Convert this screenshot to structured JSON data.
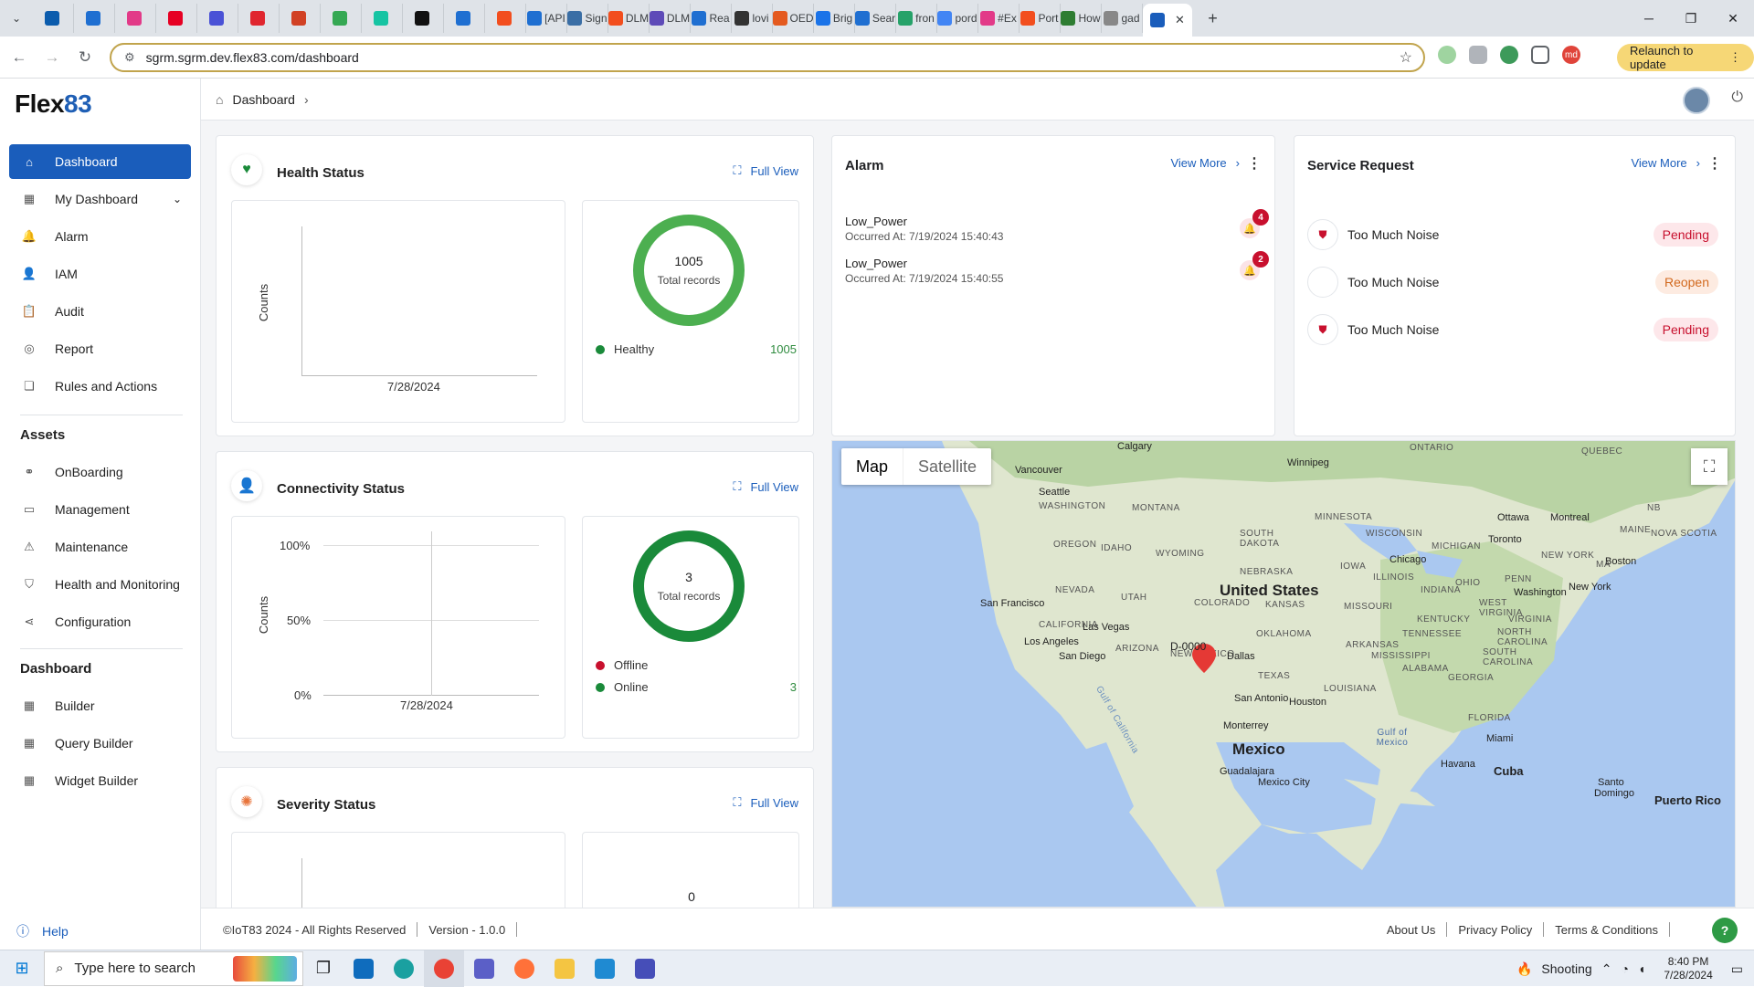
{
  "browser": {
    "tabs": [
      {
        "label": "",
        "color": "#0b5cad"
      },
      {
        "label": "",
        "color": "#1f6fd1"
      },
      {
        "label": "",
        "color": "#e23a88"
      },
      {
        "label": "",
        "color": "#e60023"
      },
      {
        "label": "",
        "color": "#4a52d6"
      },
      {
        "label": "",
        "color": "#e0262f"
      },
      {
        "label": "",
        "color": "#d14124"
      },
      {
        "label": "",
        "color": "#35a853"
      },
      {
        "label": "",
        "color": "#16c4a3"
      },
      {
        "label": "",
        "color": "#111111"
      },
      {
        "label": "",
        "color": "#1f6fd1"
      },
      {
        "label": "",
        "color": "#f24e1e"
      },
      {
        "label": "[API",
        "color": "#1f6fd1"
      },
      {
        "label": "Sign",
        "color": "#3a6ea5"
      },
      {
        "label": "DLM",
        "color": "#f24e1e"
      },
      {
        "label": "DLM",
        "color": "#5e4bb8"
      },
      {
        "label": "Rea",
        "color": "#1f6fd1"
      },
      {
        "label": "lovi",
        "color": "#333333"
      },
      {
        "label": "OED",
        "color": "#e45a1f"
      },
      {
        "label": "Brig",
        "color": "#1a73e8"
      },
      {
        "label": "Sear",
        "color": "#1f6fd1"
      },
      {
        "label": "fron",
        "color": "#26a269"
      },
      {
        "label": "pord",
        "color": "#4285f4"
      },
      {
        "label": "#Ex",
        "color": "#e23a88"
      },
      {
        "label": "Port",
        "color": "#f24e1e"
      },
      {
        "label": "How",
        "color": "#2e7d32"
      },
      {
        "label": "gad",
        "color": "#888888"
      }
    ],
    "active_tab_label": "",
    "url": "sgrm.sgrm.dev.flex83.com/dashboard",
    "relaunch_label": "Relaunch to update",
    "profile_initials": "md"
  },
  "sidebar": {
    "logo_text": "Flex",
    "logo_suffix": "83",
    "items": [
      {
        "label": "Dashboard",
        "icon": "home-icon"
      },
      {
        "label": "My Dashboard",
        "icon": "grid-icon"
      },
      {
        "label": "Alarm",
        "icon": "bell-icon"
      },
      {
        "label": "IAM",
        "icon": "user-icon"
      },
      {
        "label": "Audit",
        "icon": "clipboard-icon"
      },
      {
        "label": "Report",
        "icon": "report-icon"
      },
      {
        "label": "Rules and Actions",
        "icon": "copy-icon"
      }
    ],
    "assets_heading": "Assets",
    "assets": [
      {
        "label": "OnBoarding",
        "icon": "handshake-icon"
      },
      {
        "label": "Management",
        "icon": "monitor-icon"
      },
      {
        "label": "Maintenance",
        "icon": "warning-icon"
      },
      {
        "label": "Health and Monitoring",
        "icon": "shield-icon"
      },
      {
        "label": "Configuration",
        "icon": "share-icon"
      }
    ],
    "dashboard_heading": "Dashboard",
    "dashboard_items": [
      {
        "label": "Builder",
        "icon": "grid-icon"
      },
      {
        "label": "Query Builder",
        "icon": "grid-icon"
      },
      {
        "label": "Widget Builder",
        "icon": "grid-icon"
      }
    ],
    "help_label": "Help"
  },
  "topbar": {
    "breadcrumb": "Dashboard"
  },
  "health": {
    "title": "Health Status",
    "full_view": "Full View",
    "ylabel": "Counts",
    "xtick": "7/28/2024",
    "total": "1005",
    "total_label": "Total records",
    "legend": [
      {
        "label": "Healthy",
        "value": "1005",
        "color": "#2e9a45"
      }
    ]
  },
  "connectivity": {
    "title": "Connectivity Status",
    "full_view": "Full View",
    "ylabel": "Counts",
    "yticks": [
      "100%",
      "50%",
      "0%"
    ],
    "xtick": "7/28/2024",
    "total": "3",
    "total_label": "Total records",
    "legend": [
      {
        "label": "Offline",
        "value": "",
        "color": "#c8102e"
      },
      {
        "label": "Online",
        "value": "3",
        "color": "#1a8a3a"
      }
    ]
  },
  "severity": {
    "title": "Severity Status",
    "full_view": "Full View",
    "total": "0"
  },
  "alarm": {
    "title": "Alarm",
    "view_more": "View More",
    "items": [
      {
        "name": "Low_Power",
        "time": "Occurred At: 7/19/2024 15:40:43",
        "count": "4"
      },
      {
        "name": "Low_Power",
        "time": "Occurred At: 7/19/2024 15:40:55",
        "count": "2"
      }
    ]
  },
  "service": {
    "title": "Service Request",
    "view_more": "View More",
    "items": [
      {
        "name": "Too Much Noise",
        "status": "Pending"
      },
      {
        "name": "Too Much Noise",
        "status": "Reopen"
      },
      {
        "name": "Too Much Noise",
        "status": "Pending"
      }
    ]
  },
  "map": {
    "map_label": "Map",
    "satellite_label": "Satellite",
    "marker_label": "D-0000",
    "places": {
      "calgary": "Calgary",
      "ontario": "ONTARIO",
      "quebec": "QUEBEC",
      "winnipeg": "Winnipeg",
      "vancouver": "Vancouver",
      "seattle": "Seattle",
      "washington_st": "WASHINGTON",
      "montana": "MONTANA",
      "minnesota": "MINNESOTA",
      "ottawa": "Ottawa",
      "montreal": "Montreal",
      "maine": "MAINE",
      "nb": "NB",
      "oregon": "OREGON",
      "idaho": "IDAHO",
      "south_dakota": "SOUTH DAKOTA",
      "wisconsin": "WISCONSIN",
      "toronto": "Toronto",
      "nova_scotia": "NOVA SCOTIA",
      "michigan": "MICHIGAN",
      "wyoming": "WYOMING",
      "new_york_st": "NEW YORK",
      "boston": "Boston",
      "ma": "MA",
      "iowa": "IOWA",
      "chicago": "Chicago",
      "nebraska": "NEBRASKA",
      "nevada": "NEVADA",
      "united_states": "United States",
      "utah": "UTAH",
      "ohio": "OHIO",
      "penn": "PENN",
      "illinois": "ILLINOIS",
      "indiana": "INDIANA",
      "washington_dc": "Washington",
      "new_york": "New York",
      "san_francisco": "San Francisco",
      "colorado": "COLORADO",
      "kansas": "KANSAS",
      "missouri": "MISSOURI",
      "west_virginia": "WEST VIRGINIA",
      "california": "CALIFORNIA",
      "kentucky": "KENTUCKY",
      "las_vegas": "Las Vegas",
      "virginia": "VIRGINIA",
      "oklahoma": "OKLAHOMA",
      "tennessee": "TENNESSEE",
      "north_carolina": "NORTH CAROLINA",
      "los_angeles": "Los Angeles",
      "arizona": "ARIZONA",
      "arkansas": "ARKANSAS",
      "new_mexico": "NEW MEXICO",
      "dallas": "Dallas",
      "mississippi": "MISSISSIPPI",
      "south_carolina": "SOUTH CAROLINA",
      "san_diego": "San Diego",
      "alabama": "ALABAMA",
      "georgia": "GEORGIA",
      "texas": "TEXAS",
      "louisiana": "LOUISIANA",
      "san_antonio": "San Antonio",
      "houston": "Houston",
      "gulf_california": "Gulf of California",
      "florida": "FLORIDA",
      "monterrey": "Monterrey",
      "gulf_mexico": "Gulf of Mexico",
      "miami": "Miami",
      "mexico": "Mexico",
      "havana": "Havana",
      "cuba": "Cuba",
      "guadalajara": "Guadalajara",
      "mexico_city": "Mexico City",
      "santo": "Santo",
      "domingo": "Domingo",
      "puerto_rico": "Puerto Rico"
    }
  },
  "footer": {
    "copyright": "©IoT83 2024 - All Rights Reserved",
    "version": "Version - 1.0.0",
    "about": "About Us",
    "privacy": "Privacy Policy",
    "terms": "Terms & Conditions"
  },
  "taskbar": {
    "search_placeholder": "Type here to search",
    "weather": "Shooting",
    "time": "8:40 PM",
    "date": "7/28/2024"
  }
}
